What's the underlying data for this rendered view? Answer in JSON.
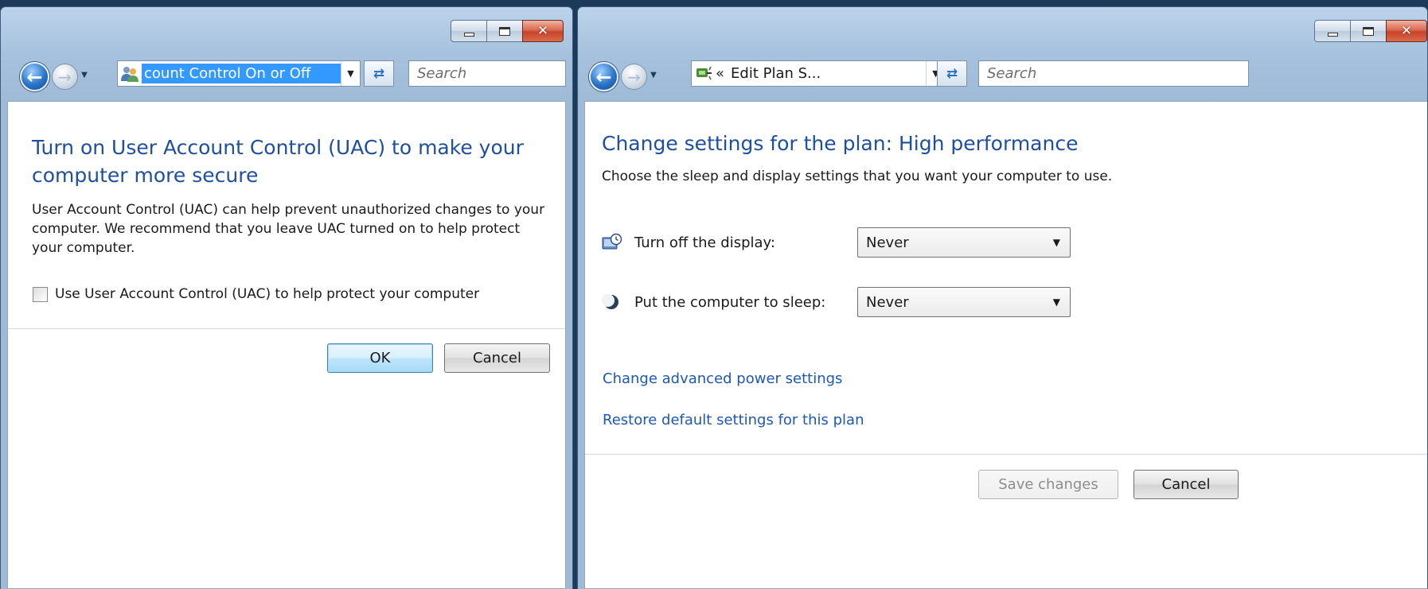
{
  "uac_window": {
    "address_text": "count Control On or Off",
    "search_placeholder": "Search",
    "heading": "Turn on User Account Control (UAC) to make your computer more secure",
    "description": "User Account Control (UAC) can help prevent unauthorized changes to your computer.  We recommend that you leave UAC turned on to help protect your computer.",
    "checkbox_label": "Use User Account Control (UAC) to help protect your computer",
    "checkbox_checked": false,
    "ok_label": "OK",
    "cancel_label": "Cancel"
  },
  "power_window": {
    "address_prefix": "«",
    "address_text": "Edit Plan S...",
    "search_placeholder": "Search",
    "heading": "Change settings for the plan: High performance",
    "subheading": "Choose the sleep and display settings that you want your computer to use.",
    "settings": [
      {
        "label": "Turn off the display:",
        "value": "Never",
        "icon": "display-clock-icon"
      },
      {
        "label": "Put the computer to sleep:",
        "value": "Never",
        "icon": "moon-sleep-icon"
      }
    ],
    "advanced_link": "Change advanced power settings",
    "restore_link": "Restore default settings for this plan",
    "save_label": "Save changes",
    "cancel_label": "Cancel"
  },
  "window_controls": {
    "close_glyph": "✕"
  },
  "colors": {
    "heading": "#1e4fa0",
    "link": "#1d58b4",
    "selection": "#3399ff"
  }
}
